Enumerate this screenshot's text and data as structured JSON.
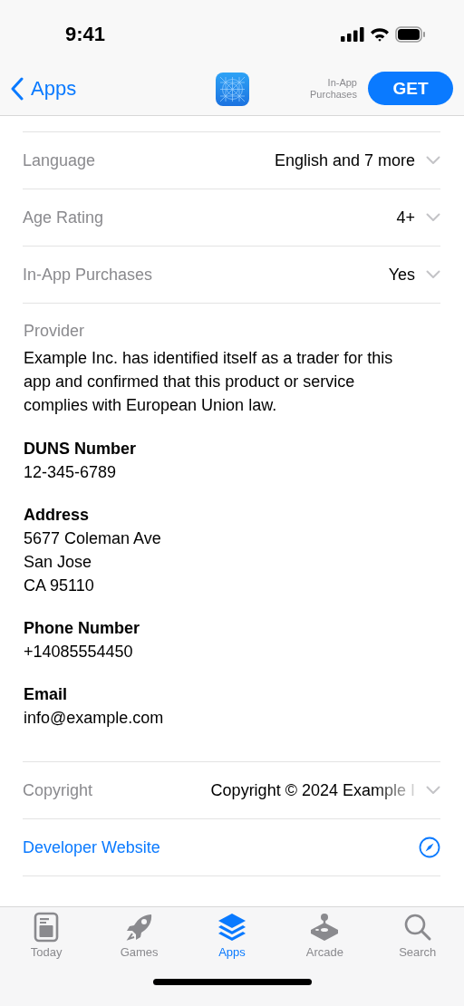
{
  "status_bar": {
    "time": "9:41"
  },
  "nav": {
    "back": "Apps",
    "iap_note": "In-App Purchases",
    "get": "GET"
  },
  "info_rows": [
    {
      "label": "Language",
      "value": "English and 7 more",
      "expanded": false
    },
    {
      "label": "Age Rating",
      "value": "4+",
      "expanded": false
    },
    {
      "label": "In-App Purchases",
      "value": "Yes",
      "expanded": false
    }
  ],
  "provider": {
    "label": "Provider",
    "text": "Example Inc. has identified itself as a trader for this app and confirmed that this product or service complies with European Union law.",
    "fields": [
      {
        "title": "DUNS Number",
        "lines": [
          "12-345-6789"
        ]
      },
      {
        "title": "Address",
        "lines": [
          "5677 Coleman Ave",
          "San Jose",
          "CA 95110"
        ]
      },
      {
        "title": "Phone Number",
        "lines": [
          "+14085554450"
        ]
      },
      {
        "title": "Email",
        "lines": [
          "info@example.com"
        ]
      }
    ]
  },
  "copyright": {
    "label": "Copyright",
    "value": "Copyright © 2024 Example I",
    "expanded": false
  },
  "developer_link": "Developer Website",
  "tab_bar": [
    {
      "label": "Today",
      "kind": "today",
      "selected": false
    },
    {
      "label": "Games",
      "kind": "games",
      "selected": false
    },
    {
      "label": "Apps",
      "kind": "apps",
      "selected": true
    },
    {
      "label": "Arcade",
      "kind": "arcade",
      "selected": false
    },
    {
      "label": "Search",
      "kind": "search",
      "selected": false
    }
  ]
}
